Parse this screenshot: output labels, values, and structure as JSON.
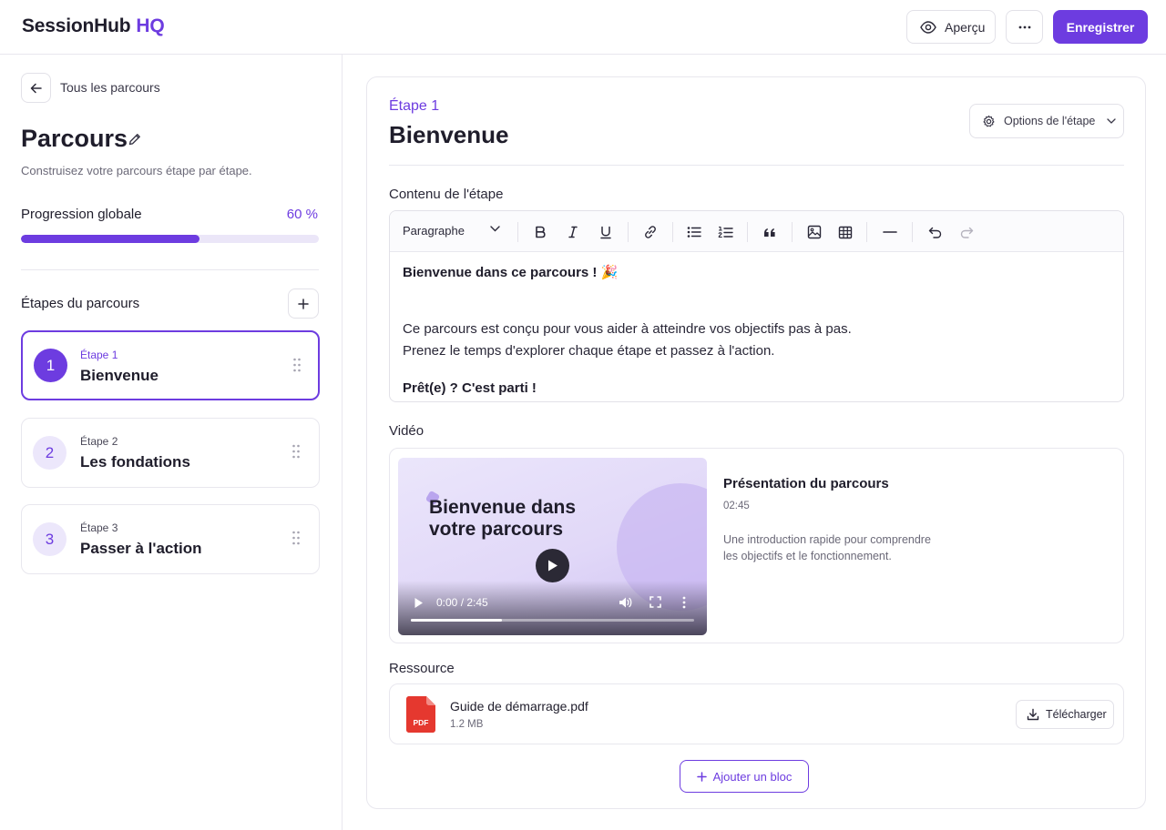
{
  "header": {
    "logo_main": "SessionHub",
    "logo_accent": "HQ",
    "preview_label": "Aperçu",
    "save_label": "Enregistrer",
    "more_icon": "ellipsis-icon",
    "preview_icon": "eye-icon"
  },
  "sidebar": {
    "back_label": "Tous les parcours",
    "title": "Parcours",
    "subtitle": "Construisez votre parcours étape par étape.",
    "progress_label": "Progression globale",
    "progress_value": "60 %",
    "progress_fraction": 0.6,
    "steps_label": "Étapes du parcours",
    "steps": [
      {
        "number": "1",
        "kicker": "Étape 1",
        "name": "Bienvenue",
        "active": true
      },
      {
        "number": "2",
        "kicker": "Étape 2",
        "name": "Les fondations",
        "active": false
      },
      {
        "number": "3",
        "kicker": "Étape 3",
        "name": "Passer à l'action",
        "active": false
      }
    ]
  },
  "main": {
    "eyebrow": "Étape 1",
    "title": "Bienvenue",
    "options_label": "Options de l'étape",
    "content_label": "Contenu de l'étape",
    "toolbar": {
      "format_select": "Paragraphe",
      "icons": [
        "bold-icon",
        "italic-icon",
        "underline-icon",
        "link-icon",
        "bullet-list-icon",
        "numbered-list-icon",
        "quote-icon",
        "image-icon",
        "table-icon",
        "horizontal-rule-icon",
        "undo-icon",
        "redo-icon"
      ]
    },
    "editor": {
      "heading": "Bienvenue dans ce parcours ! 🎉",
      "line1": "Ce parcours est conçu pour vous aider à atteindre vos objectifs pas à pas.",
      "line2": "Prenez le temps d'explorer chaque étape et passez à l'action.",
      "closing": "Prêt(e) ? C'est parti !"
    },
    "video_label": "Vidéo",
    "video": {
      "caption_line1": "Bienvenue dans",
      "caption_line2": "votre parcours",
      "time": "0:00 / 2:45",
      "progress_fraction": 0.32,
      "title": "Présentation du parcours",
      "duration": "02:45",
      "description_line1": "Une introduction rapide pour comprendre",
      "description_line2": "les objectifs et le fonctionnement."
    },
    "resource_label": "Ressource",
    "resource": {
      "file_name": "Guide de démarrage.pdf",
      "file_size": "1.2 MB",
      "file_type": "PDF",
      "download_label": "Télécharger"
    },
    "add_block_label": "Ajouter un bloc"
  },
  "colors": {
    "accent": "#6d3ce0",
    "accent_light": "#ece7fb",
    "pdf_red": "#e5382f"
  }
}
